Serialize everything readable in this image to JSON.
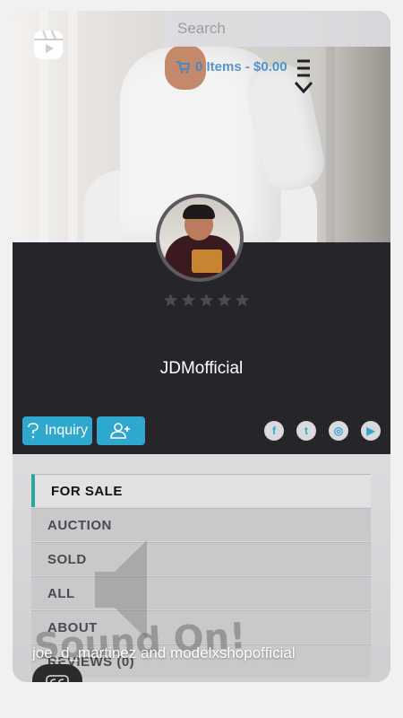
{
  "search": {
    "placeholder": "Search"
  },
  "cart": {
    "label": "0 Items - $0.00"
  },
  "profile": {
    "username": "JDMofficial",
    "rating_stars": 0,
    "rating_max": 5
  },
  "actions": {
    "inquiry_label": "Inquiry"
  },
  "socials": [
    {
      "icon": "facebook-icon",
      "glyph": "f"
    },
    {
      "icon": "twitter-icon",
      "glyph": "t"
    },
    {
      "icon": "instagram-icon",
      "glyph": "◎"
    },
    {
      "icon": "youtube-icon",
      "glyph": "▶"
    }
  ],
  "tabs": [
    {
      "label": "FOR SALE",
      "active": true
    },
    {
      "label": "AUCTION"
    },
    {
      "label": "SOLD"
    },
    {
      "label": "ALL"
    },
    {
      "label": "ABOUT"
    },
    {
      "label": "REVIEWS (0)"
    }
  ],
  "overlay": {
    "sound_text": "Sound On!",
    "caption": "joe_d_martinez and modelxshopofficial"
  },
  "colors": {
    "accent": "#2fa7cf",
    "band": "#26252b",
    "active_tab_marker": "#2aa6a0"
  }
}
